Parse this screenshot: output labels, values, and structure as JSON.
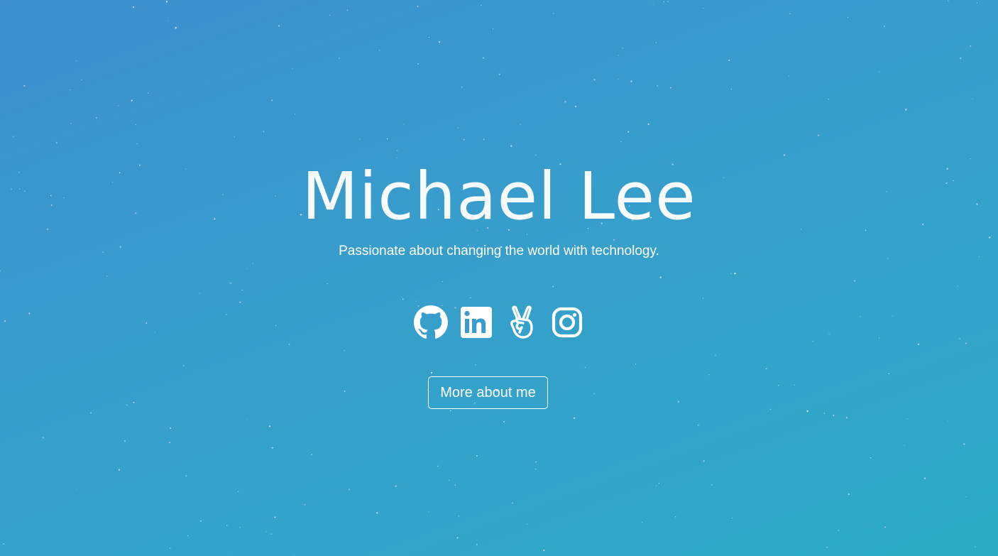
{
  "colors": {
    "background_start": "#3d8fcf",
    "background_end": "#2daac6",
    "foreground": "#ffffff"
  },
  "hero": {
    "name": "Michael Lee",
    "tagline": "Passionate about changing the world with technology.",
    "cta_label": "More about me"
  },
  "socials": [
    {
      "icon": "github-icon"
    },
    {
      "icon": "linkedin-icon"
    },
    {
      "icon": "angellist-icon"
    },
    {
      "icon": "instagram-icon"
    }
  ]
}
